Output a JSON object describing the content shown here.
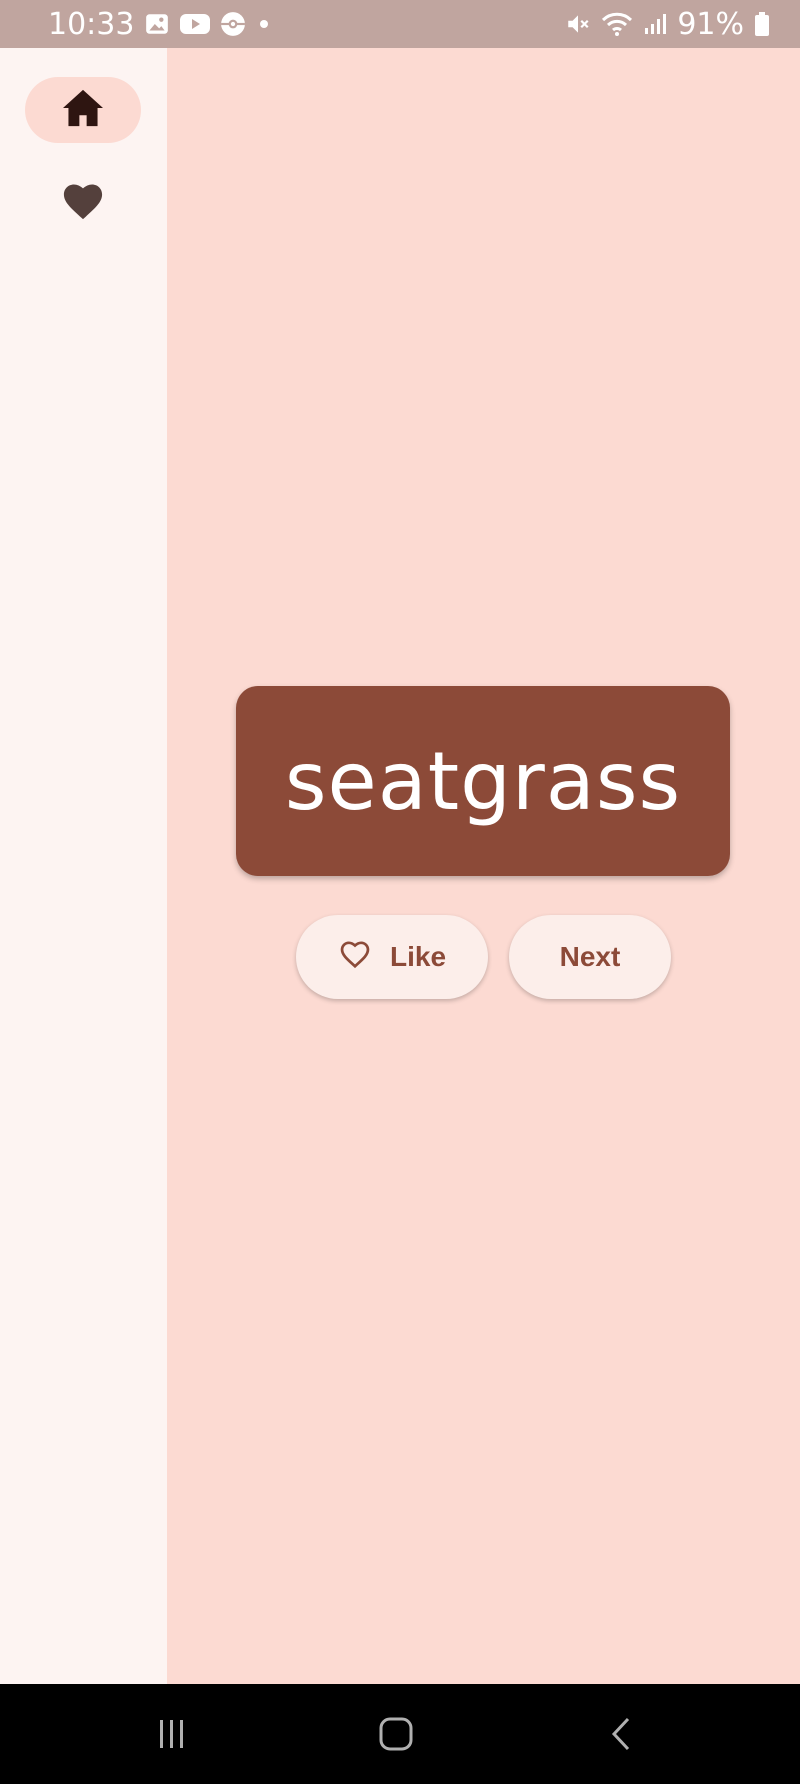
{
  "status_bar": {
    "time": "10:33",
    "battery": "91%",
    "left_icons": [
      "gallery-icon",
      "youtube-icon",
      "pokeball-icon",
      "dot-icon"
    ],
    "right_icons": [
      "mute-icon",
      "wifi-icon",
      "signal-icon",
      "battery-icon"
    ]
  },
  "nav_rail": {
    "items": [
      {
        "icon": "home-icon",
        "selected": true
      },
      {
        "icon": "heart-icon",
        "selected": false
      }
    ]
  },
  "main": {
    "word": "seatgrass",
    "like_label": "Like",
    "next_label": "Next"
  },
  "system_nav": {
    "buttons": [
      "recents-icon",
      "home-icon",
      "back-icon"
    ]
  },
  "colors": {
    "background": "#fcdad2",
    "rail": "#fdf4f2",
    "card": "#8c4a38",
    "button": "#fceeea"
  }
}
